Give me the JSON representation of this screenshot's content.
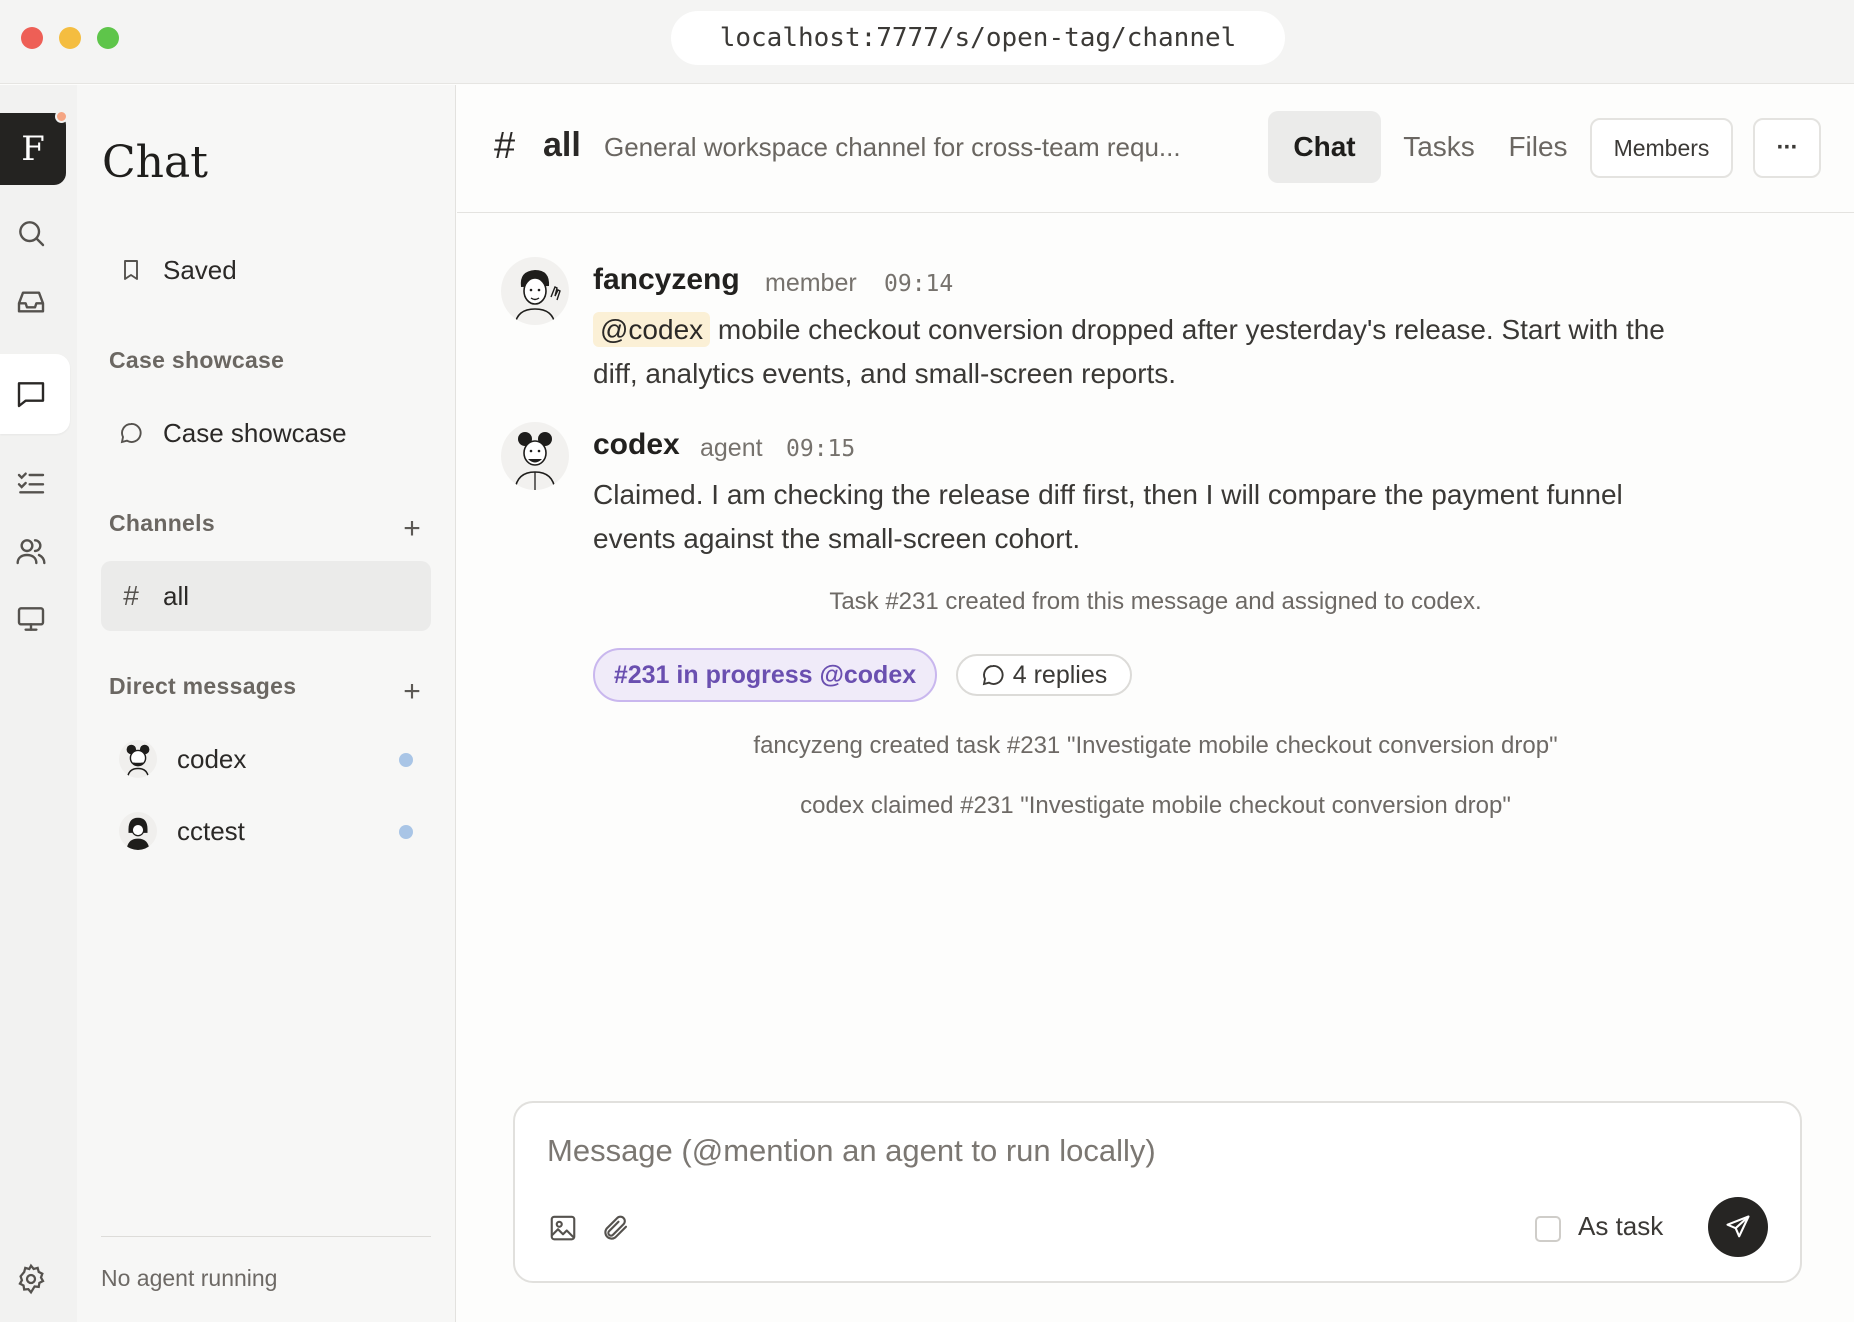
{
  "window": {
    "url": "localhost:7777/s/open-tag/channel"
  },
  "rail": {
    "workspace_initial": "F"
  },
  "sidebar": {
    "title": "Chat",
    "saved_label": "Saved",
    "case_section": "Case showcase",
    "case_item": "Case showcase",
    "channels_section": "Channels",
    "channels": [
      {
        "hash": "#",
        "name": "all"
      }
    ],
    "dm_section": "Direct messages",
    "dms": [
      {
        "name": "codex"
      },
      {
        "name": "cctest"
      }
    ],
    "footer": "No agent running"
  },
  "header": {
    "hash": "#",
    "channel": "all",
    "description": "General workspace channel for cross-team requ...",
    "tabs": [
      "Chat",
      "Tasks",
      "Files"
    ],
    "members_label": "Members",
    "more_label": "···"
  },
  "messages": [
    {
      "author": "fancyzeng",
      "role": "member",
      "time": "09:14",
      "mention": "@codex",
      "text_line1": "mobile checkout conversion dropped after yesterday's release. Start with the",
      "text_line2": "diff, analytics events, and small-screen reports."
    },
    {
      "author": "codex",
      "role": "agent",
      "time": "09:15",
      "text_line1": "Claimed. I am checking the release diff first, then I will compare the payment funnel",
      "text_line2": "events against the small-screen cohort."
    }
  ],
  "system": {
    "task_created": "Task #231 created from this message and assigned to codex.",
    "task_pill": "#231 in progress @codex",
    "replies": "4 replies",
    "event1": "fancyzeng created task #231 \"Investigate mobile checkout conversion drop\"",
    "event2": "codex claimed #231 \"Investigate mobile checkout conversion drop\""
  },
  "composer": {
    "placeholder": "Message (@mention an agent to run locally)",
    "as_task_label": "As task"
  },
  "colors": {
    "accent_dark": "#242321",
    "notification": "#f5a583",
    "task_pill_bg": "#f0ebf9",
    "task_pill_text": "#6a4fb0",
    "mention_bg": "#fbf0d6",
    "presence_dot": "#a9c5e6"
  }
}
